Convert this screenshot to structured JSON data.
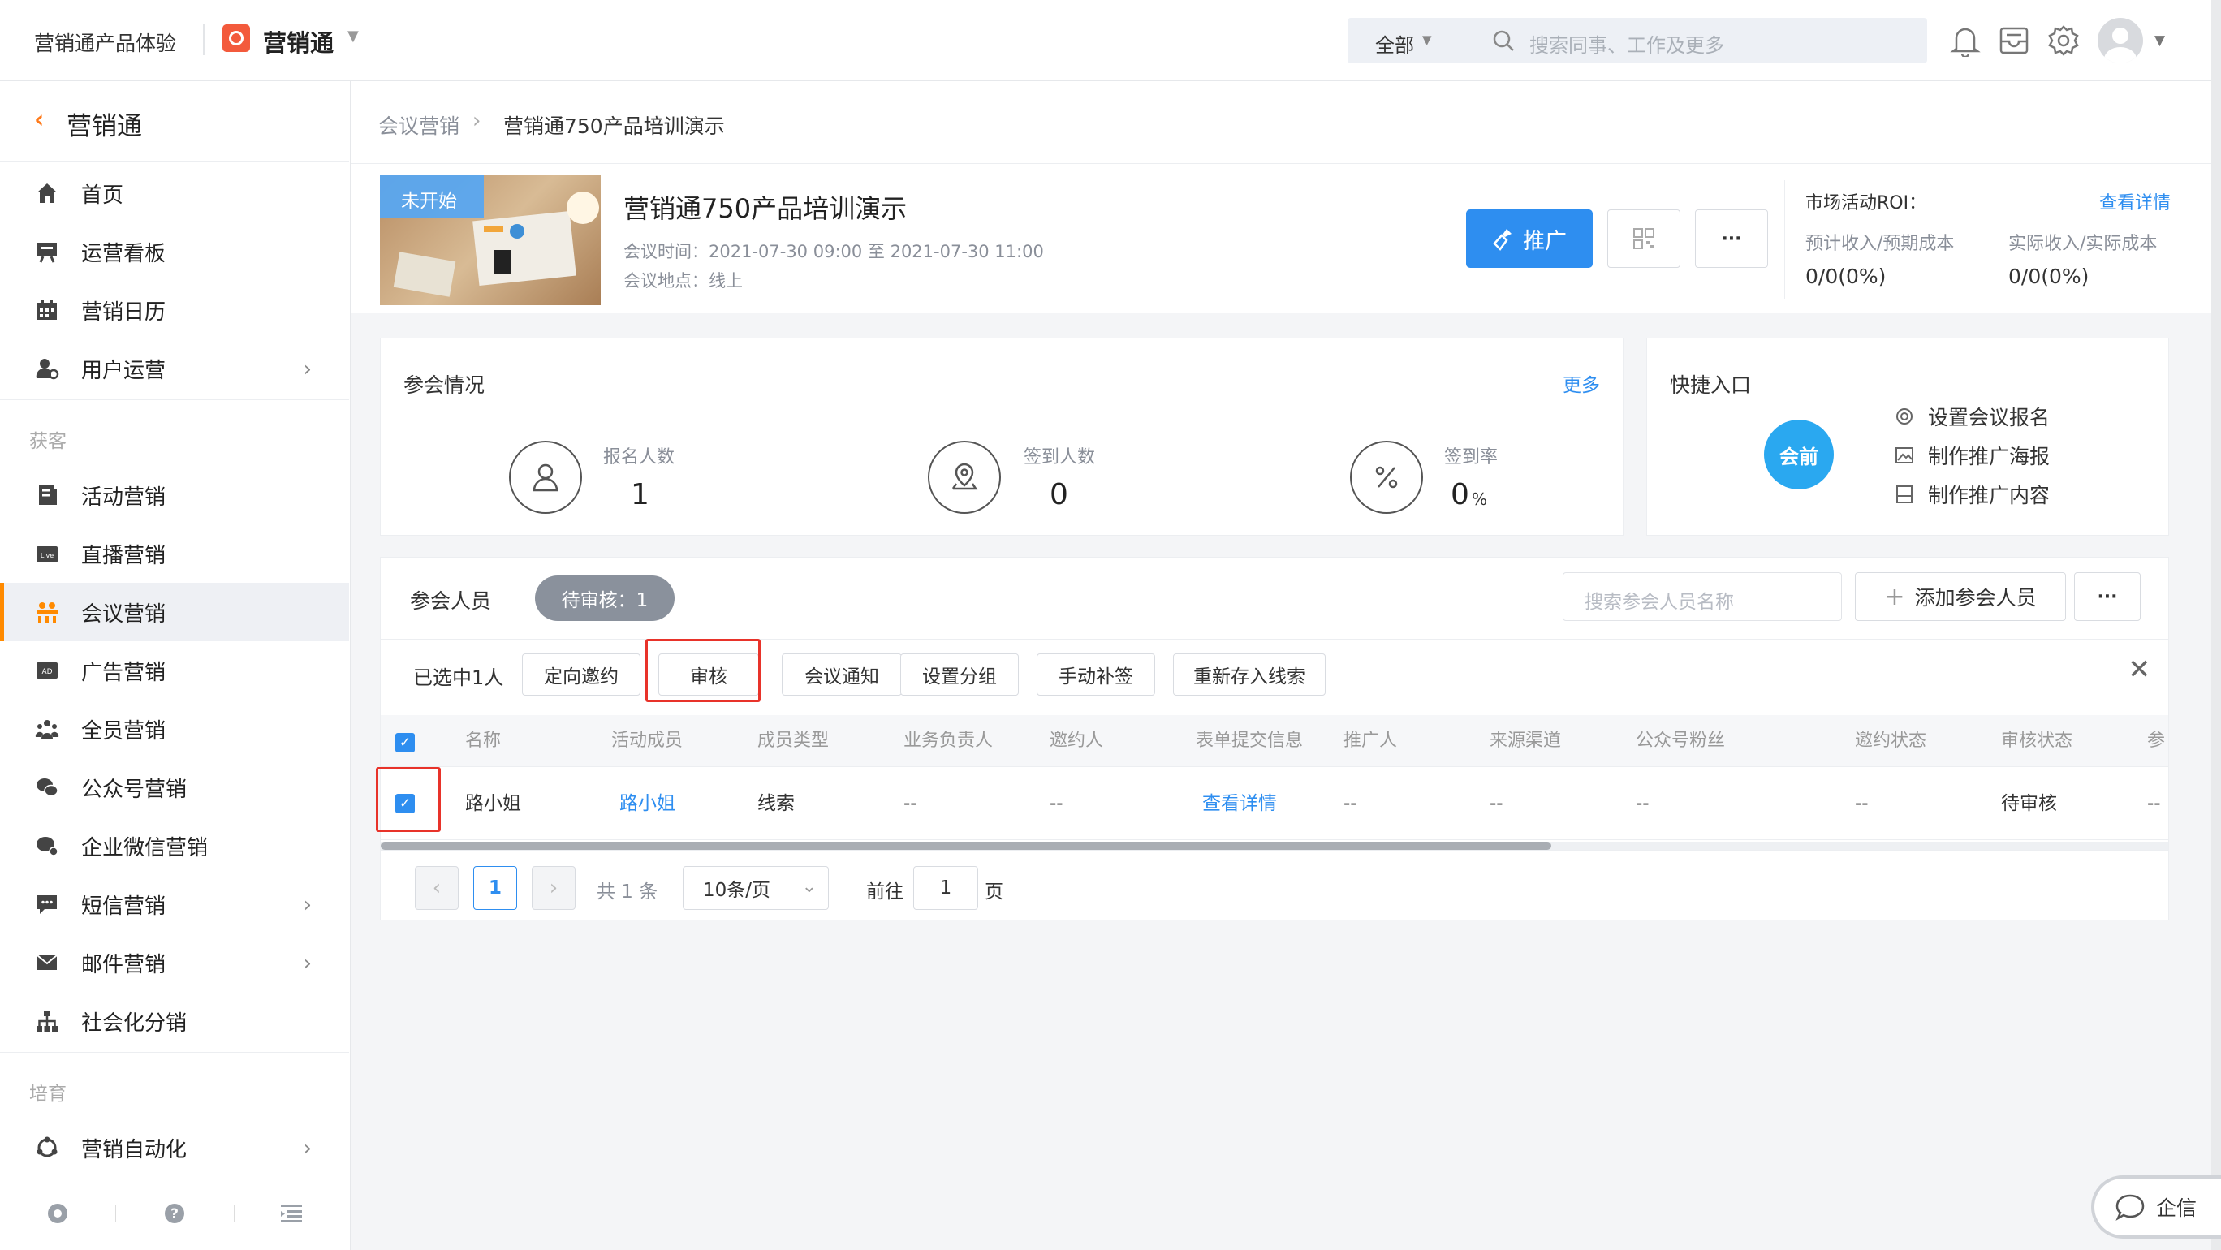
{
  "topbar": {
    "app_name": "营销通产品体验",
    "product_name": "营销通",
    "scope_select": "全部",
    "search_placeholder": "搜索同事、工作及更多"
  },
  "sidebar": {
    "title": "营销通",
    "items": [
      {
        "label": "首页"
      },
      {
        "label": "运营看板"
      },
      {
        "label": "营销日历"
      },
      {
        "label": "用户运营"
      },
      {
        "label": "活动营销"
      },
      {
        "label": "直播营销"
      },
      {
        "label": "会议营销"
      },
      {
        "label": "广告营销"
      },
      {
        "label": "全员营销"
      },
      {
        "label": "公众号营销"
      },
      {
        "label": "企业微信营销"
      },
      {
        "label": "短信营销"
      },
      {
        "label": "邮件营销"
      },
      {
        "label": "社会化分销"
      },
      {
        "label": "营销自动化"
      }
    ],
    "group_acquire": "获客",
    "group_nurture": "培育"
  },
  "breadcrumb": {
    "parent": "会议营销",
    "current": "营销通750产品培训演示"
  },
  "event": {
    "status_badge": "未开始",
    "title": "营销通750产品培训演示",
    "time": "会议时间：2021-07-30 09:00 至 2021-07-30 11:00",
    "location": "会议地点：线上",
    "promote_label": "推广",
    "more_label": "···"
  },
  "roi": {
    "title": "市场活动ROI：",
    "detail_link": "查看详情",
    "expected_label": "预计收入/预期成本",
    "expected_value": "0/0(0%)",
    "actual_label": "实际收入/实际成本",
    "actual_value": "0/0(0%)"
  },
  "attendance": {
    "title": "参会情况",
    "more_link": "更多",
    "registered_label": "报名人数",
    "registered_value": "1",
    "signed_label": "签到人数",
    "signed_value": "0",
    "rate_label": "签到率",
    "rate_value": "0",
    "rate_unit": "%"
  },
  "quick": {
    "title": "快捷入口",
    "badge": "会前",
    "links": [
      "设置会议报名",
      "制作推广海报",
      "制作推广内容"
    ]
  },
  "participants": {
    "title": "参会人员",
    "pending_tab": "待审核：1",
    "search_placeholder": "搜索参会人员名称",
    "add_button": "添加参会人员",
    "more_label": "···",
    "selected_count": "已选中1人",
    "actions": [
      "定向邀约",
      "审核",
      "会议通知",
      "设置分组",
      "手动补签",
      "重新存入线索"
    ],
    "columns": [
      "名称",
      "活动成员",
      "成员类型",
      "业务负责人",
      "邀约人",
      "表单提交信息",
      "推广人",
      "来源渠道",
      "公众号粉丝",
      "邀约状态",
      "审核状态",
      "参"
    ],
    "rows": [
      {
        "name": "路小姐",
        "member": "路小姐",
        "type": "线索",
        "owner": "--",
        "inviter": "--",
        "form": "查看详情",
        "promoter": "--",
        "channel": "--",
        "fan": "--",
        "invite_status": "--",
        "review_status": "待审核",
        "last": "--"
      }
    ]
  },
  "pagination": {
    "current_page": "1",
    "total": "共 1 条",
    "page_size": "10条/页",
    "goto_label": "前往",
    "goto_value": "1",
    "page_suffix": "页"
  },
  "float_chat": {
    "label": "企信"
  },
  "colors": {
    "accent": "#2e8ef0",
    "orange": "#ff8a00",
    "highlight": "#e8332a",
    "badge": "#2aa8f0"
  }
}
